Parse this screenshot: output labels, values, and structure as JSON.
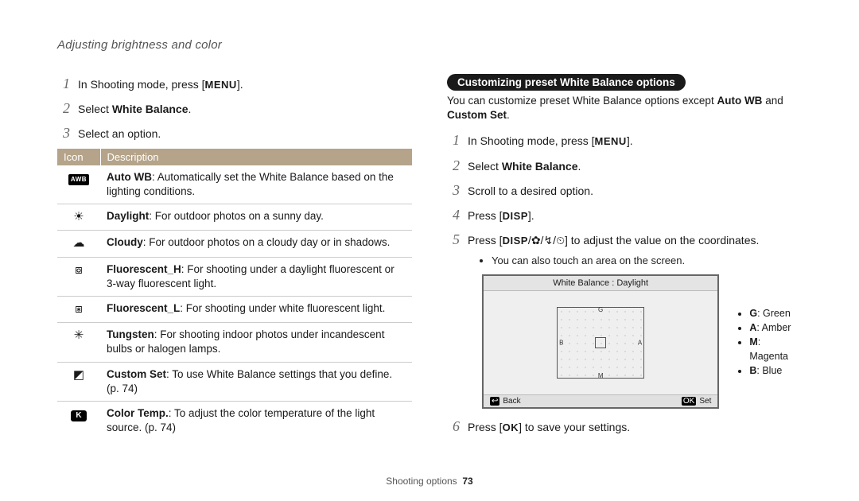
{
  "page_title": "Adjusting brightness and color",
  "footer_section": "Shooting options",
  "footer_page": "73",
  "left": {
    "step1_prefix": "In Shooting mode, press [",
    "step1_btn": "MENU",
    "step1_suffix": "].",
    "step2_prefix": "Select ",
    "step2_bold": "White Balance",
    "step2_suffix": ".",
    "step3": "Select an option.",
    "table": {
      "head_icon": "Icon",
      "head_desc": "Description",
      "rows": [
        {
          "icon_label": "AWB",
          "icon_kind": "badge-awb",
          "b": "Auto WB",
          "t": ": Automatically set the White Balance based on the lighting conditions."
        },
        {
          "icon_label": "☀",
          "icon_kind": "glyph",
          "b": "Daylight",
          "t": ": For outdoor photos on a sunny day."
        },
        {
          "icon_label": "☁",
          "icon_kind": "glyph",
          "b": "Cloudy",
          "t": ": For outdoor photos on a cloudy day or in shadows."
        },
        {
          "icon_label": "⧇",
          "icon_kind": "glyph",
          "b": "Fluorescent_H",
          "t": ": For shooting under a daylight fluorescent or 3-way fluorescent light."
        },
        {
          "icon_label": "⧆",
          "icon_kind": "glyph",
          "b": "Fluorescent_L",
          "t": ": For shooting under white fluorescent light."
        },
        {
          "icon_label": "✳",
          "icon_kind": "glyph",
          "b": "Tungsten",
          "t": ": For shooting indoor photos under incandescent bulbs or halogen lamps."
        },
        {
          "icon_label": "◩",
          "icon_kind": "glyph",
          "b": "Custom Set",
          "t": ": To use White Balance settings that you define. (p. 74)"
        },
        {
          "icon_label": "K",
          "icon_kind": "badge-k",
          "b": "Color Temp.",
          "t": ": To adjust the color temperature of the light source. (p. 74)"
        }
      ]
    }
  },
  "right": {
    "heading": "Customizing preset White Balance options",
    "intro_a": "You can customize preset White Balance options except ",
    "intro_b1": "Auto WB",
    "intro_mid": " and ",
    "intro_b2": "Custom Set",
    "intro_end": ".",
    "step1_prefix": "In Shooting mode, press [",
    "step1_btn": "MENU",
    "step1_suffix": "].",
    "step2_prefix": "Select ",
    "step2_bold": "White Balance",
    "step2_suffix": ".",
    "step3": "Scroll to a desired option.",
    "step4_prefix": "Press [",
    "step4_btn": "DISP",
    "step4_suffix": "].",
    "step5_prefix": "Press [",
    "step5_btn": "DISP",
    "step5_sep": "/",
    "step5_icon1": "✿",
    "step5_icon2": "↯",
    "step5_icon3": "⏲",
    "step5_mid": "] to adjust the value on the coordinates.",
    "step5_sub": "You can also touch an area on the screen.",
    "screen_title": "White Balance : Daylight",
    "screen_back": "Back",
    "screen_set": "Set",
    "legend": [
      {
        "k": "G",
        "v": ": Green"
      },
      {
        "k": "A",
        "v": ": Amber"
      },
      {
        "k": "M",
        "v": ": Magenta"
      },
      {
        "k": "B",
        "v": ": Blue"
      }
    ],
    "step6_prefix": "Press [",
    "step6_btn": "OK",
    "step6_suffix": "] to save your settings."
  }
}
